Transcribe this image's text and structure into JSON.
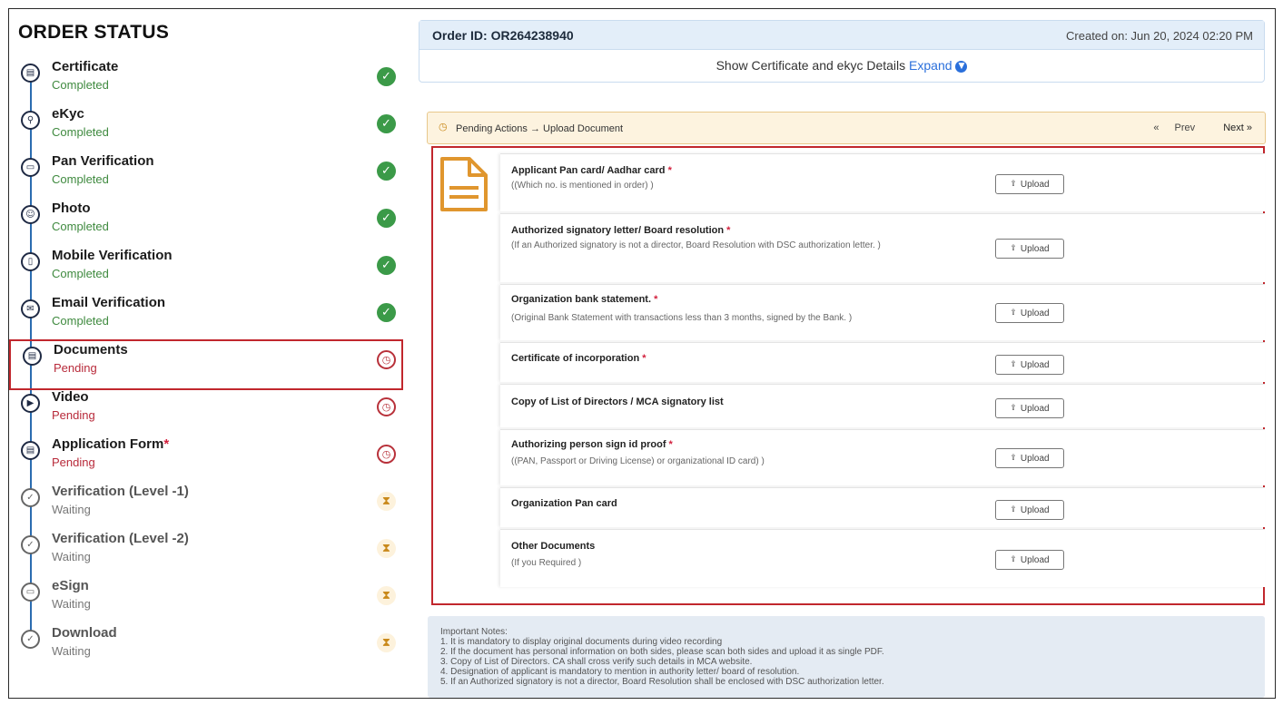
{
  "sidebar": {
    "title": "ORDER STATUS",
    "steps": [
      {
        "label": "Certificate",
        "status": "Completed",
        "icon": "certificate-icon",
        "state": "completed"
      },
      {
        "label": "eKyc",
        "status": "Completed",
        "icon": "search-icon",
        "state": "completed"
      },
      {
        "label": "Pan Verification",
        "status": "Completed",
        "icon": "card-icon",
        "state": "completed"
      },
      {
        "label": "Photo",
        "status": "Completed",
        "icon": "photo-icon",
        "state": "completed"
      },
      {
        "label": "Mobile Verification",
        "status": "Completed",
        "icon": "mobile-icon",
        "state": "completed"
      },
      {
        "label": "Email Verification",
        "status": "Completed",
        "icon": "email-icon",
        "state": "completed"
      },
      {
        "label": "Documents",
        "status": "Pending",
        "icon": "document-icon",
        "state": "pending"
      },
      {
        "label": "Video",
        "status": "Pending",
        "icon": "video-icon",
        "state": "pending"
      },
      {
        "label": "Application Form",
        "status": "Pending",
        "icon": "document-icon",
        "state": "pending",
        "required": "*"
      },
      {
        "label": "Verification (Level -1)",
        "status": "Waiting",
        "icon": "shield-icon",
        "state": "waiting"
      },
      {
        "label": "Verification (Level -2)",
        "status": "Waiting",
        "icon": "shield-icon",
        "state": "waiting"
      },
      {
        "label": "eSign",
        "status": "Waiting",
        "icon": "card-icon",
        "state": "waiting"
      },
      {
        "label": "Download",
        "status": "Waiting",
        "icon": "shield-icon",
        "state": "waiting"
      }
    ]
  },
  "order": {
    "id_label": "Order ID: OR264238940",
    "created": "Created on: Jun 20, 2024 02:20 PM",
    "show_details": "Show Certificate and ekyc Details",
    "expand_label": "Expand"
  },
  "pending": {
    "text": "Pending Actions → Upload Document",
    "prev": "Prev",
    "next": "Next"
  },
  "documents": {
    "upload_label": "Upload",
    "items": [
      {
        "title": "Applicant Pan card/ Aadhar card",
        "required": "*",
        "desc": "((Which no. is mentioned in order) )"
      },
      {
        "title": "Authorized signatory letter/ Board resolution",
        "required": "*",
        "desc": "(If an Authorized signatory is not a director, Board Resolution with DSC authorization letter. )"
      },
      {
        "title": "Organization bank statement.",
        "required": "*",
        "desc": "(Original Bank Statement with transactions less than 3 months, signed by the Bank. )"
      },
      {
        "title": "Certificate of incorporation",
        "required": "*",
        "desc": ""
      },
      {
        "title": "Copy of List of Directors / MCA signatory list",
        "required": "",
        "desc": ""
      },
      {
        "title": "Authorizing person sign id proof",
        "required": "*",
        "desc": "((PAN, Passport or Driving License) or organizational ID card) )"
      },
      {
        "title": "Organization Pan card",
        "required": "",
        "desc": ""
      },
      {
        "title": "Other Documents",
        "required": "",
        "desc": "(If you Required )"
      }
    ]
  },
  "notes": {
    "heading": "Important Notes:",
    "lines": [
      "1. It is mandatory to display original documents during video recording",
      "2. If the document has personal information on both sides, please scan both sides and upload it as single PDF.",
      "3. Copy of List of Directors. CA shall cross verify such details in MCA website.",
      "4. Designation of applicant is mandatory to mention in authority letter/ board of resolution.",
      "5. If an Authorized signatory is not a director, Board Resolution shall be enclosed with DSC authorization letter."
    ]
  },
  "colors": {
    "completed": "#3b9a48",
    "pending": "#b8313a",
    "waiting": "#c9891a",
    "accent": "#2a6fdb",
    "highlight_border": "#c1272d"
  }
}
